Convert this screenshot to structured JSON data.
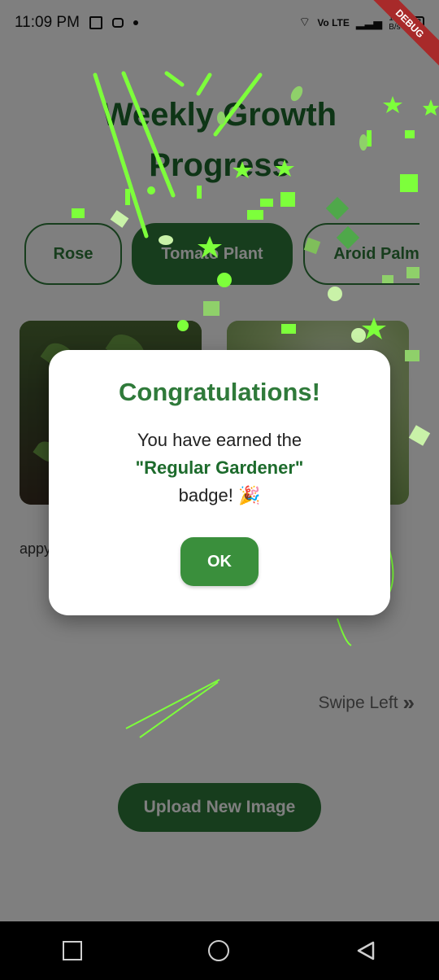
{
  "status_bar": {
    "time": "11:09 PM",
    "network": "Vo LTE",
    "speed_value": "109",
    "speed_unit": "B/s",
    "battery": "68"
  },
  "debug_banner": "DEBUG",
  "page": {
    "title": "Weekly Growth Progress",
    "plants": [
      {
        "label": "Rose",
        "selected": false
      },
      {
        "label": "Tomato Plant",
        "selected": true
      },
      {
        "label": "Aroid Palm",
        "selected": false
      }
    ],
    "caption": "appy",
    "swipe_hint": "Swipe Left",
    "upload_button": "Upload New Image"
  },
  "dialog": {
    "title": "Congratulations!",
    "line1": "You have earned the",
    "badge": "\"Regular Gardener\"",
    "line2": "badge! 🎉",
    "ok_button": "OK"
  },
  "colors": {
    "primary_green": "#2f7a3a",
    "dark_green": "#1d6b2c",
    "confetti_green": "#7dff3b"
  }
}
